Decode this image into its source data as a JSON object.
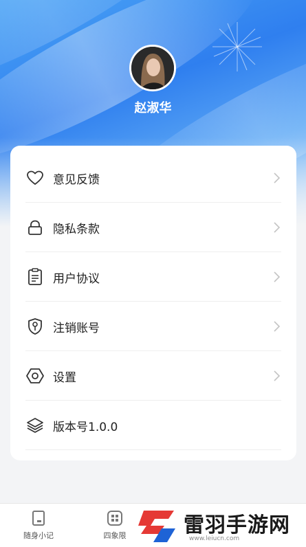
{
  "profile": {
    "username": "赵淑华",
    "avatar_icon": "user-avatar-photo"
  },
  "menu": {
    "items": [
      {
        "label": "意见反馈",
        "icon": "heart-icon"
      },
      {
        "label": "隐私条款",
        "icon": "lock-icon"
      },
      {
        "label": "用户协议",
        "icon": "document-icon"
      },
      {
        "label": "注销账号",
        "icon": "shield-key-icon"
      },
      {
        "label": "设置",
        "icon": "settings-hex-icon"
      },
      {
        "label": "版本号1.0.0",
        "icon": "layers-icon"
      }
    ]
  },
  "tabbar": {
    "tabs": [
      {
        "label": "随身小记",
        "icon": "notebook-icon"
      },
      {
        "label": "四象限",
        "icon": "grid-icon"
      }
    ]
  },
  "watermark": {
    "text": "雷羽手游网",
    "url": "www.leiucn.com"
  },
  "colors": {
    "primary_blue": "#2f7fef",
    "logo_red": "#e53935",
    "logo_blue": "#1e63d6"
  }
}
